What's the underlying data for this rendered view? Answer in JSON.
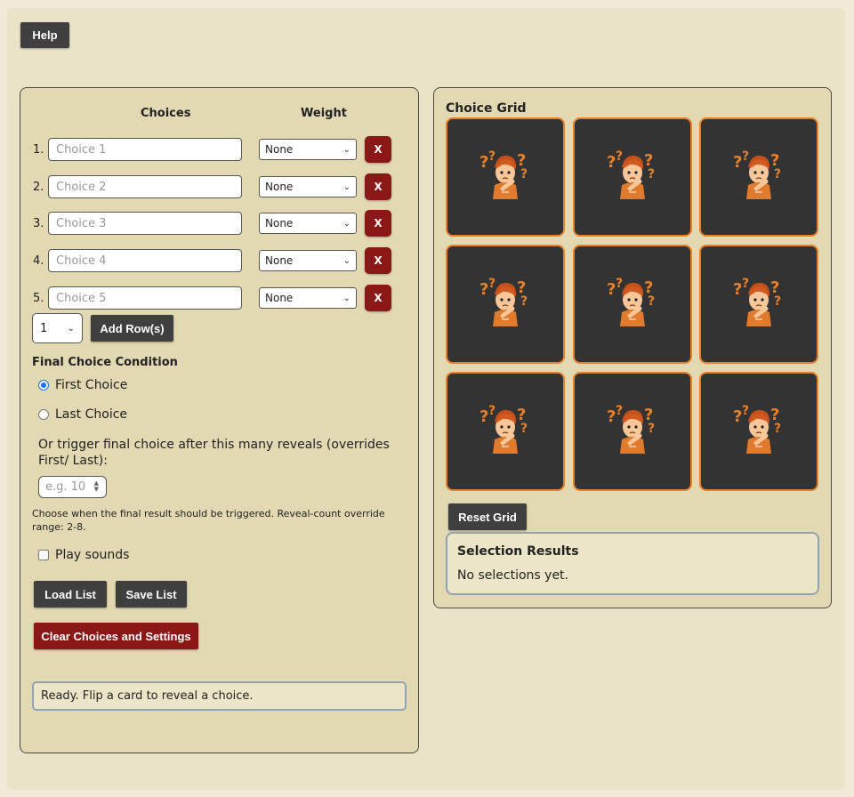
{
  "header": {
    "help_label": "Help"
  },
  "choices_panel": {
    "col_choices": "Choices",
    "col_weight": "Weight",
    "rows": [
      {
        "num": "1.",
        "placeholder": "Choice 1",
        "weight": "None",
        "delete": "X"
      },
      {
        "num": "2.",
        "placeholder": "Choice 2",
        "weight": "None",
        "delete": "X"
      },
      {
        "num": "3.",
        "placeholder": "Choice 3",
        "weight": "None",
        "delete": "X"
      },
      {
        "num": "4.",
        "placeholder": "Choice 4",
        "weight": "None",
        "delete": "X"
      },
      {
        "num": "5.",
        "placeholder": "Choice 5",
        "weight": "None",
        "delete": "X"
      }
    ],
    "row_count_value": "1",
    "add_rows_label": "Add Row(s)",
    "final_heading": "Final Choice Condition",
    "radio_first": "First Choice",
    "radio_last": "Last Choice",
    "selected_condition": "First Choice",
    "trigger_text": "Or trigger final choice after this many reveals (overrides First/ Last):",
    "reveal_placeholder": "e.g. 10",
    "range_note": "Choose when the final result should be triggered. Reveal-count override range: 2-8.",
    "play_sounds_label": "Play sounds",
    "play_sounds_checked": false,
    "load_label": "Load List",
    "save_label": "Save List",
    "clear_label": "Clear Choices and Settings",
    "status": "Ready. Flip a card to reveal a choice."
  },
  "grid_panel": {
    "title": "Choice Grid",
    "card_icon": "thinking-character-icon",
    "card_count": 9,
    "reset_label": "Reset Grid",
    "results_title": "Selection Results",
    "results_text": "No selections yet."
  },
  "colors": {
    "accent_red": "#8c1717",
    "button_dark": "#3f3f3f",
    "card_bg": "#333333",
    "card_border": "#e8802a",
    "panel_bg": "#e2d8b2",
    "radio_accent": "#1a73d9"
  }
}
